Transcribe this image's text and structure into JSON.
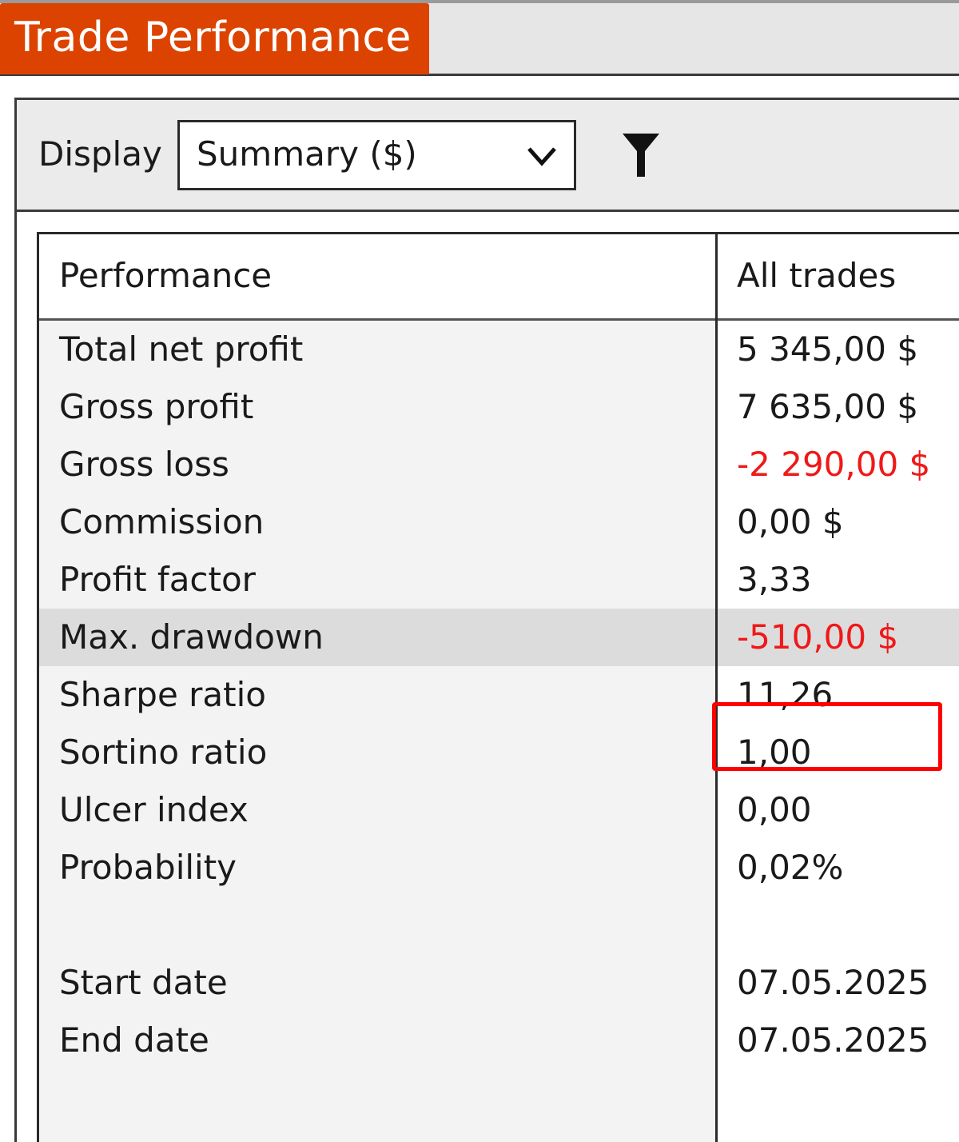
{
  "window": {
    "title": "Trade Performance"
  },
  "toolbar": {
    "display_label": "Display",
    "display_select": {
      "value": "Summary ($)",
      "icon": "chevron-down-icon"
    },
    "filter_icon": "filter-icon"
  },
  "grid": {
    "columns": [
      "Performance",
      "All trades"
    ],
    "rows": [
      {
        "metric": "Total net profit",
        "value": "5 345,00 $",
        "negative": false
      },
      {
        "metric": "Gross profit",
        "value": "7 635,00 $",
        "negative": false
      },
      {
        "metric": "Gross loss",
        "value": "-2 290,00 $",
        "negative": true
      },
      {
        "metric": "Commission",
        "value": "0,00 $",
        "negative": false
      },
      {
        "metric": "Profit factor",
        "value": "3,33",
        "negative": false
      },
      {
        "metric": "Max. drawdown",
        "value": "-510,00 $",
        "negative": true,
        "selected": true,
        "annotated": true
      },
      {
        "metric": "Sharpe ratio",
        "value": "11,26",
        "negative": false
      },
      {
        "metric": "Sortino ratio",
        "value": "1,00",
        "negative": false
      },
      {
        "metric": "Ulcer index",
        "value": "0,00",
        "negative": false
      },
      {
        "metric": "Probability",
        "value": "0,02%",
        "negative": false
      },
      {
        "metric": "",
        "value": "",
        "negative": false
      },
      {
        "metric": "Start date",
        "value": "07.05.2025",
        "negative": false
      },
      {
        "metric": "End date",
        "value": "07.05.2025",
        "negative": false
      }
    ]
  },
  "colors": {
    "title_tab": "#dd4300",
    "negative_value": "#f01818",
    "annotation_box": "#ff0000",
    "selected_row": "#dcdcdc"
  }
}
